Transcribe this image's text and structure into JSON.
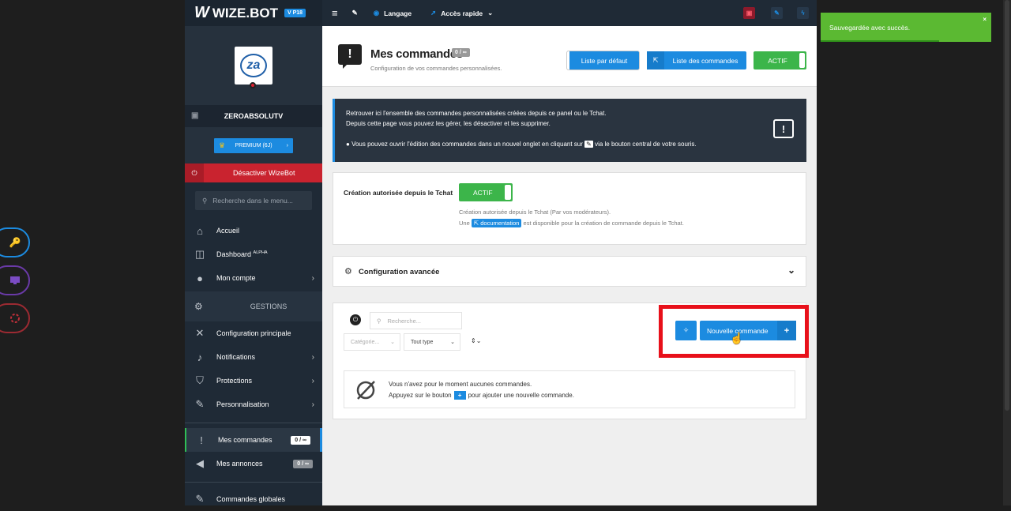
{
  "brand": {
    "logo_mark": "W",
    "name": "WIZE.BOT",
    "version": "V P18"
  },
  "profile": {
    "avatar_text": "za",
    "username": "ZEROABSOLUTV",
    "premium_label": "PREMIUM (6J)",
    "deactivate_label": "Désactiver WizeBot"
  },
  "sidebar": {
    "search_placeholder": "Recherche dans le menu...",
    "items": [
      {
        "label": "Accueil"
      },
      {
        "label": "Dashboard",
        "sup": "ALPHA"
      },
      {
        "label": "Mon compte"
      }
    ],
    "section_label": "GESTIONS",
    "gestion_items": [
      {
        "label": "Configuration principale"
      },
      {
        "label": "Notifications"
      },
      {
        "label": "Protections"
      },
      {
        "label": "Personnalisation"
      }
    ],
    "commands": {
      "label": "Mes commandes",
      "badge": "0 / ∞"
    },
    "annonces": {
      "label": "Mes annonces",
      "badge": "0 / ∞"
    },
    "global": {
      "label": "Commandes globales"
    }
  },
  "topbar": {
    "language": "Langage",
    "quick_access": "Accès rapide"
  },
  "header": {
    "title": "Mes commandes",
    "badge": "0 / ∞",
    "subtitle": "Configuration de vos commandes personnalisées.",
    "btn_default_list": "Liste par défaut",
    "btn_command_list": "Liste des commandes",
    "btn_active": "ACTIF"
  },
  "info": {
    "line1": "Retrouver ici l'ensemble des commandes personnalisées créées depuis ce panel ou le Tchat.",
    "line2": "Depuis cette page vous pouvez les gérer, les désactiver et les supprimer.",
    "line3_pre": "Vous pouvez ouvrir l'édition des commandes dans un nouvel onglet en cliquant sur",
    "line3_post": "via le bouton central de votre souris."
  },
  "chat_creation": {
    "label": "Création autorisée depuis le Tchat",
    "toggle": "ACTIF",
    "desc": "Création autorisée depuis le Tchat (Par vos modérateurs).",
    "doc_pre": "Une",
    "doc_link": "documentation",
    "doc_post": "est disponible pour la création de commande depuis le Tchat."
  },
  "advanced": {
    "label": "Configuration avancée"
  },
  "filters": {
    "search_placeholder": "Recherche...",
    "category_placeholder": "Catégorie...",
    "type_value": "Tout type"
  },
  "new_command": {
    "label": "Nouvelle commande"
  },
  "empty": {
    "line1": "Vous n'avez pour le moment aucunes commandes.",
    "line2_pre": "Appuyez sur le bouton",
    "line2_post": "pour ajouter une nouvelle commande."
  },
  "toast": {
    "message": "Sauvegardée avec succès.",
    "close": "×"
  },
  "colors": {
    "accent": "#1c8be0",
    "success": "#3cb54a",
    "danger": "#c9232f",
    "highlight": "#e8101a",
    "toast": "#5bb932"
  }
}
